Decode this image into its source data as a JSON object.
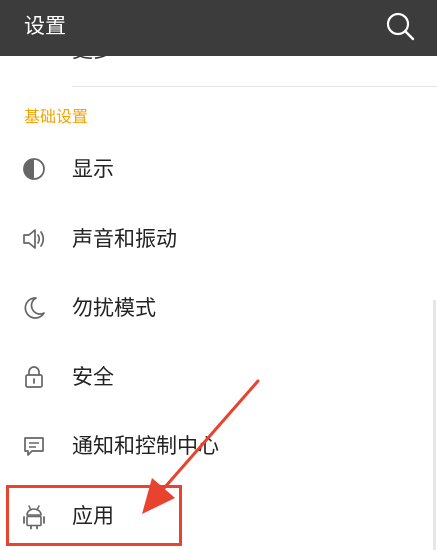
{
  "appbar": {
    "title": "设置",
    "search_icon": "search-icon"
  },
  "previous_item": {
    "label": "更多"
  },
  "section": {
    "title": "基础设置"
  },
  "items": [
    {
      "label": "显示",
      "icon": "display-icon"
    },
    {
      "label": "声音和振动",
      "icon": "speaker-icon"
    },
    {
      "label": "勿扰模式",
      "icon": "moon-icon"
    },
    {
      "label": "安全",
      "icon": "lock-icon"
    },
    {
      "label": "通知和控制中心",
      "icon": "notification-icon"
    },
    {
      "label": "应用",
      "icon": "android-icon"
    }
  ],
  "colors": {
    "appbar": "#3c3c3c",
    "section_header": "#f4a300",
    "annotation": "#e8432e"
  }
}
